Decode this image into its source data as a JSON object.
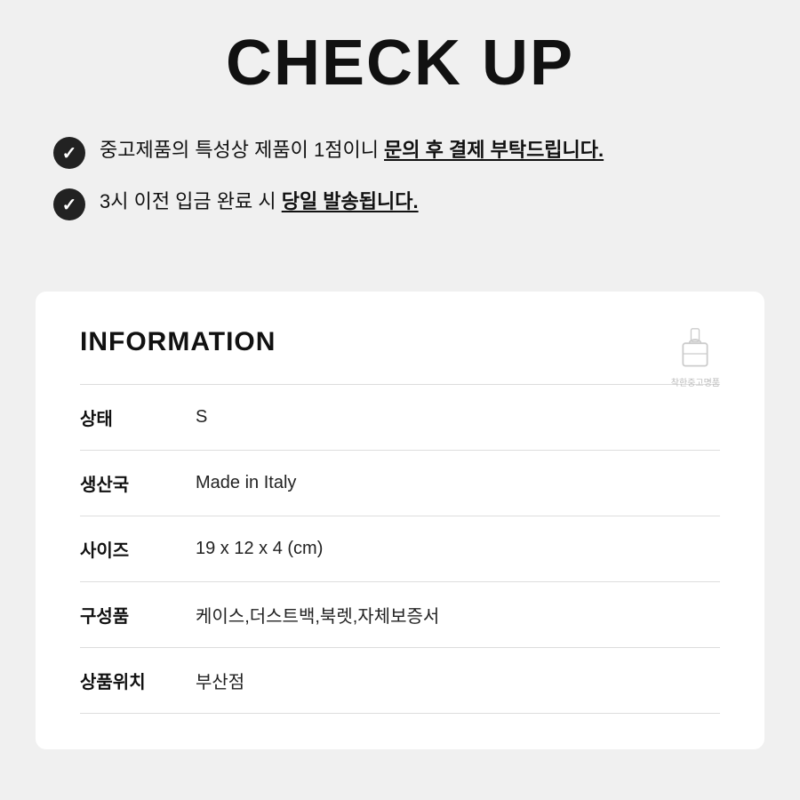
{
  "header": {
    "title": "CHECK UP"
  },
  "checkItems": [
    {
      "id": "check1",
      "text_before": "중고제품의 특성상 제품이 1점이니 ",
      "text_highlight": "문의 후 결제 부탁드립니다.",
      "text_after": ""
    },
    {
      "id": "check2",
      "text_before": "3시 이전 입금 완료 시 ",
      "text_highlight": "당일 발송됩니다.",
      "text_after": ""
    }
  ],
  "info": {
    "title": "INFORMATION",
    "brand_line1": "착한중고명품",
    "rows": [
      {
        "label": "상태",
        "value": "S"
      },
      {
        "label": "생산국",
        "value": "Made in Italy"
      },
      {
        "label": "사이즈",
        "value": "19 x 12 x 4 (cm)"
      },
      {
        "label": "구성품",
        "value": "케이스,더스트백,북렛,자체보증서"
      },
      {
        "label": "상품위치",
        "value": "부산점"
      }
    ]
  }
}
